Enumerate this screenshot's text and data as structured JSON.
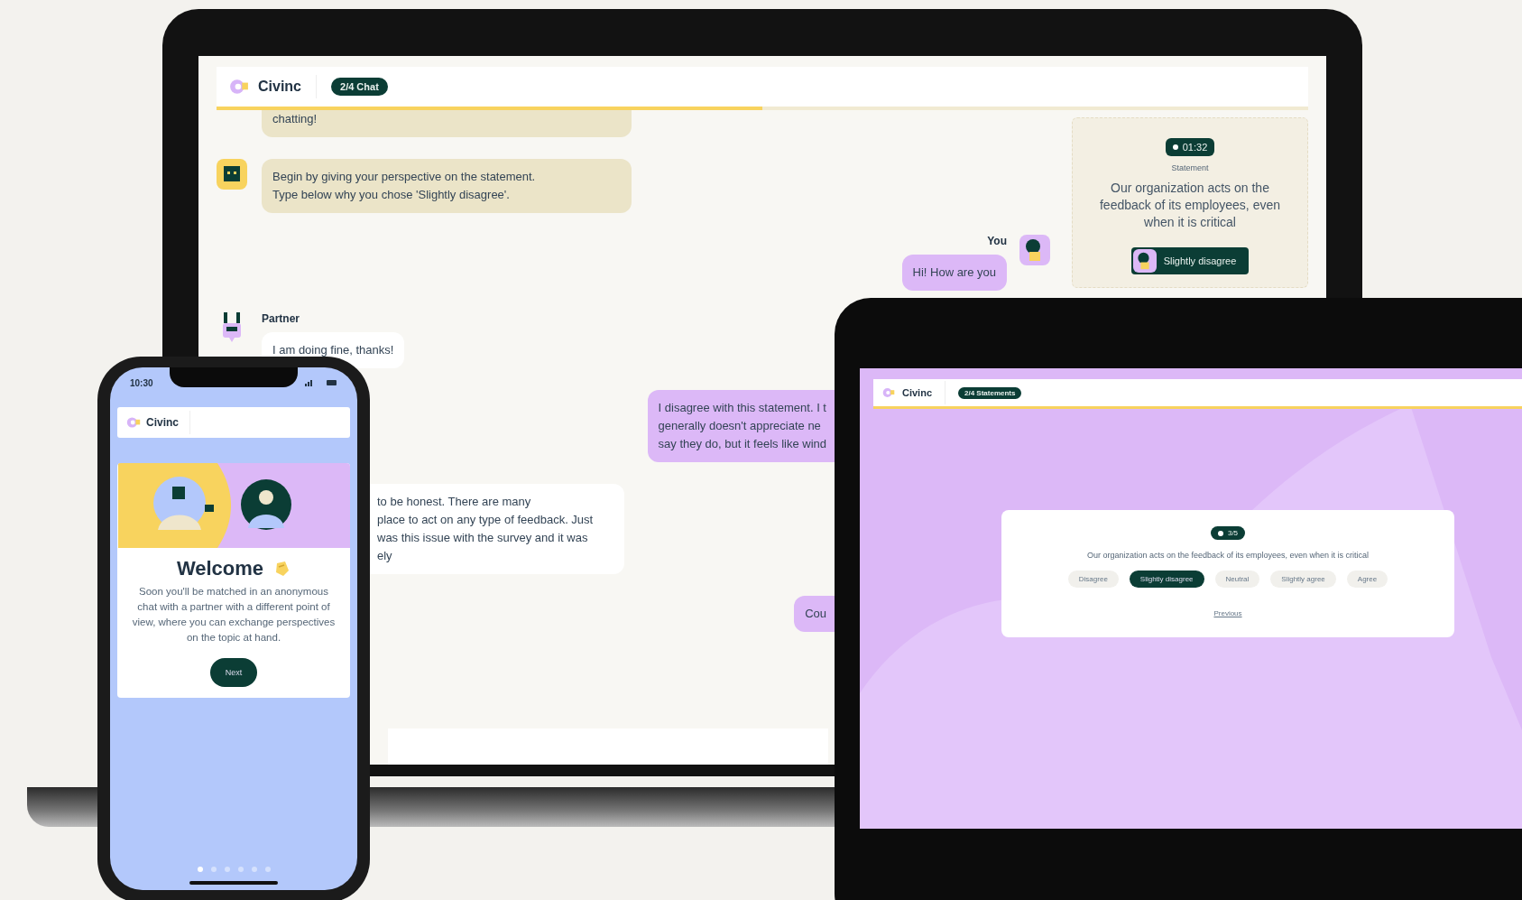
{
  "laptop": {
    "header": {
      "logo": "Civinc",
      "step": "2/4 Chat",
      "level": 0.5
    },
    "messages": [
      {
        "kind": "bot",
        "avatar": false,
        "text": "chatting!"
      },
      {
        "kind": "bot",
        "avatar": true,
        "text": "Begin by giving your perspective on the statement.\nType below why you chose 'Slightly disagree'."
      },
      {
        "kind": "you",
        "sender": "You",
        "cut_off": false,
        "text": "Hi! How are you"
      },
      {
        "kind": "partner",
        "sender": "Partner",
        "cut_off": false,
        "text": "I am doing fine, thanks!"
      },
      {
        "kind": "you",
        "cut_off": true,
        "text": "I disagree with this statement. I t\ngenerally doesn't appreciate ne\nsay they do, but it feels like wind"
      },
      {
        "kind": "partner",
        "cut_off": true,
        "text": "to be honest. There are many\nplace to act on any type of feedback. Just\nwas this issue with the survey and it was\nely"
      },
      {
        "kind": "you",
        "cut_off": true,
        "text": "Cou"
      }
    ],
    "statement_card": {
      "timer": "01:32",
      "label": "Statement",
      "statement": "Our organization acts on the feedback of its employees, even when it is critical",
      "choice": "Slightly disagree"
    }
  },
  "phone": {
    "time": "10:30",
    "logo": "Civinc",
    "title": "Welcome",
    "body": "Soon you'll be matched in an anonymous chat with a partner with a different point of view, where you can exchange perspectives on the topic at hand.",
    "button": "Next",
    "pages": [
      {
        "selected": true
      },
      {
        "selected": false
      },
      {
        "selected": false
      },
      {
        "selected": false
      },
      {
        "selected": false
      },
      {
        "selected": false
      }
    ]
  },
  "tablet": {
    "header": {
      "logo": "Civinc",
      "step": "2/4 Statements",
      "level": 1
    },
    "timer": "3/5",
    "statement": "Our organization acts on the feedback of its employees, even when it is critical",
    "options": [
      {
        "label": "Disagree",
        "selected": false
      },
      {
        "label": "Slightly disagree",
        "selected": true
      },
      {
        "label": "Neutral",
        "selected": false
      },
      {
        "label": "Slightly agree",
        "selected": false
      },
      {
        "label": "Agree",
        "selected": false
      }
    ],
    "previous": "Previous"
  }
}
